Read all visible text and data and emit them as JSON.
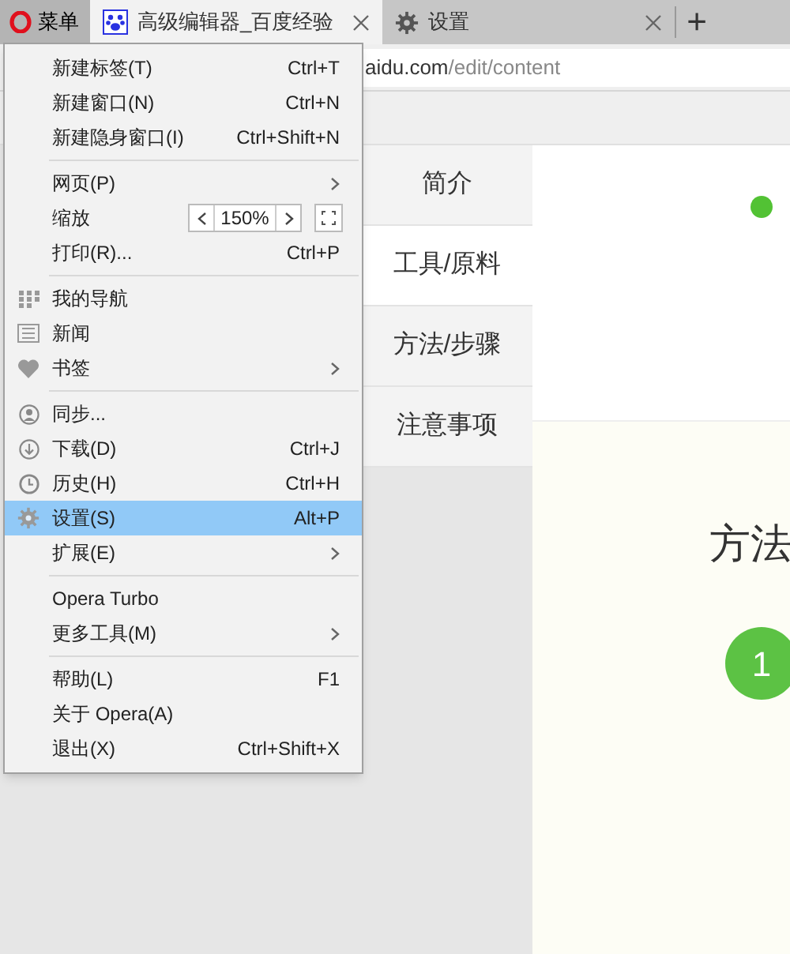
{
  "tabs": [
    {
      "kind": "menu",
      "label": "菜单",
      "selected": false
    },
    {
      "kind": "page",
      "label": "高级编辑器_百度经验",
      "selected": true
    },
    {
      "kind": "settings",
      "label": "设置",
      "selected": false
    }
  ],
  "new_tab": "+",
  "address": {
    "host": "aidu.com",
    "path": "/edit/content"
  },
  "nav": [
    {
      "label": "简介",
      "selected": false
    },
    {
      "label": "工具/原料",
      "selected": true
    },
    {
      "label": "方法/步骤",
      "selected": false
    },
    {
      "label": "注意事项",
      "selected": false
    }
  ],
  "content": {
    "heading": "方法",
    "step": "1"
  },
  "menu": [
    [
      {
        "kind": "item",
        "label": "新建标签(T)",
        "shortcut": "Ctrl+T",
        "highlighted": false
      },
      {
        "kind": "item",
        "label": "新建窗口(N)",
        "shortcut": "Ctrl+N",
        "highlighted": false
      },
      {
        "kind": "item",
        "label": "新建隐身窗口(I)",
        "shortcut": "Ctrl+Shift+N",
        "highlighted": false
      }
    ],
    [
      {
        "kind": "submenu",
        "label": "网页(P)",
        "highlighted": false
      },
      {
        "kind": "zoom",
        "label": "缩放",
        "value": "150%",
        "highlighted": false
      },
      {
        "kind": "item",
        "label": "打印(R)...",
        "shortcut": "Ctrl+P",
        "highlighted": false
      }
    ],
    [
      {
        "kind": "item",
        "label": "我的导航",
        "highlighted": false
      },
      {
        "kind": "item",
        "label": "新闻",
        "highlighted": false
      },
      {
        "kind": "submenu",
        "label": "书签",
        "highlighted": false
      }
    ],
    [
      {
        "kind": "item",
        "label": "同步...",
        "highlighted": false
      },
      {
        "kind": "item",
        "label": "下载(D)",
        "shortcut": "Ctrl+J",
        "highlighted": false
      },
      {
        "kind": "item",
        "label": "历史(H)",
        "shortcut": "Ctrl+H",
        "highlighted": false
      },
      {
        "kind": "item",
        "label": "设置(S)",
        "shortcut": "Alt+P",
        "highlighted": true
      },
      {
        "kind": "submenu",
        "label": "扩展(E)",
        "highlighted": false
      }
    ],
    [
      {
        "kind": "item",
        "label": "Opera Turbo",
        "highlighted": false
      },
      {
        "kind": "submenu",
        "label": "更多工具(M)",
        "highlighted": false
      }
    ],
    [
      {
        "kind": "item",
        "label": "帮助(L)",
        "shortcut": "F1",
        "highlighted": false
      },
      {
        "kind": "item",
        "label": "关于 Opera(A)",
        "highlighted": false
      },
      {
        "kind": "item",
        "label": "退出(X)",
        "shortcut": "Ctrl+Shift+X",
        "highlighted": false
      }
    ]
  ]
}
